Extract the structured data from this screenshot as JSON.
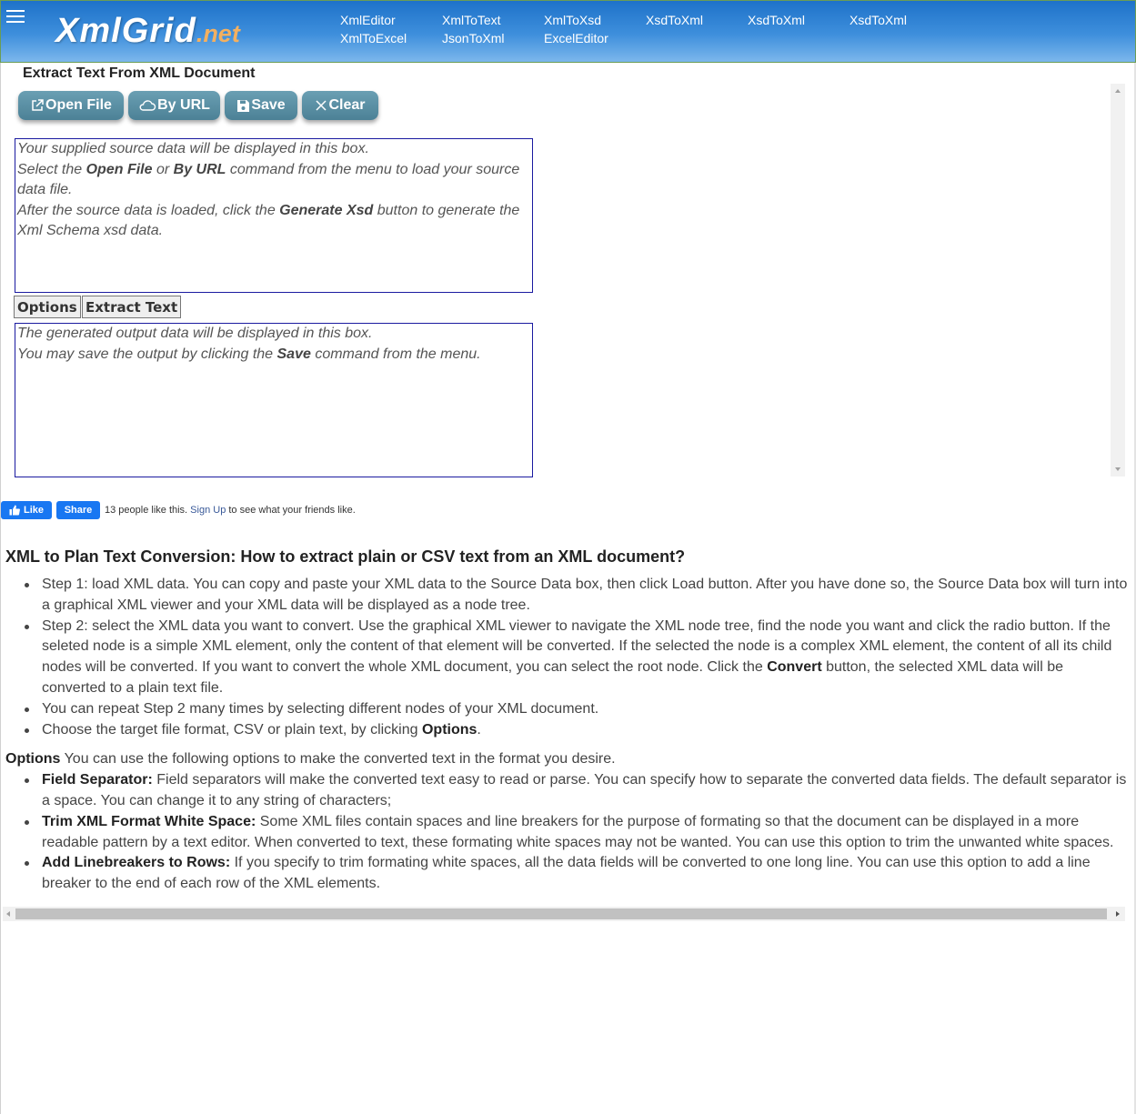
{
  "header": {
    "logo_main": "XmlGrid",
    "logo_ext": ".net",
    "nav": [
      {
        "label": "XmlEditor"
      },
      {
        "label": "XmlToText"
      },
      {
        "label": "XmlToXsd"
      },
      {
        "label": "XsdToXml"
      },
      {
        "label": "XsdToXml"
      },
      {
        "label": "XsdToXml"
      },
      {
        "label": "XmlToExcel"
      },
      {
        "label": "JsonToXml"
      },
      {
        "label": "ExcelEditor"
      }
    ]
  },
  "converter": {
    "title": "Extract Text From XML Document",
    "toolbar": {
      "open_file": "Open File",
      "by_url": "By URL",
      "save": "Save",
      "clear": "Clear"
    },
    "source_box": {
      "line1": "Your supplied source data will be displayed in this box.",
      "line2_a": "Select the ",
      "line2_b": "Open File",
      "line2_c": " or ",
      "line2_d": "By URL",
      "line2_e": " command from the menu to load your source data file.",
      "line3_a": "After the source data is loaded, click the ",
      "line3_b": "Generate Xsd",
      "line3_c": " button to generate the Xml Schema xsd data."
    },
    "options_button": "Options",
    "extract_button": "Extract Text",
    "output_box": {
      "line1": "The generated output data will be displayed in this box.",
      "line2_a": "You may save the output by clicking the ",
      "line2_b": "Save",
      "line2_c": " command from the menu."
    }
  },
  "facebook": {
    "like": "Like",
    "share": "Share",
    "text_a": "13 people like this. ",
    "signup": "Sign Up",
    "text_b": " to see what your friends like."
  },
  "article": {
    "title": "XML to Plan Text Conversion: How to extract plain or CSV text from an XML document?",
    "steps": [
      {
        "text": "Step 1: load XML data. You can copy and paste your XML data to the Source Data box, then click Load button. After you have done so, the Source Data box will turn into a graphical XML viewer and your XML data will be displayed as a node tree."
      },
      {
        "text_a": "Step 2: select the XML data you want to convert. Use the graphical XML viewer to navigate the XML node tree, find the node you want and click the radio button. If the seleted node is a simple XML element, only the content of that element will be converted. If the selected the node is a complex XML element, the content of all its child nodes will be converted. If you want to convert the whole XML document, you can select the root node. Click the ",
        "bold": "Convert",
        "text_b": " button, the selected XML data will be converted to a plain text file."
      },
      {
        "text": "You can repeat Step 2 many times by selecting different nodes of your XML document."
      },
      {
        "text_a": "Choose the target file format, CSV or plain text, by clicking ",
        "bold": "Options",
        "text_b": "."
      }
    ],
    "options_label": "Options",
    "options_intro": " You can use the following options to make the converted text in the format you desire.",
    "options": [
      {
        "label": "Field Separator:",
        "text": " Field separators will make the converted text easy to read or parse. You can specify how to separate the converted data fields. The default separator is a space. You can change it to any string of characters;"
      },
      {
        "label": "Trim XML Format White Space:",
        "text": " Some XML files contain spaces and line breakers for the purpose of formating so that the document can be displayed in a more readable pattern by a text editor. When converted to text, these formating white spaces may not be wanted. You can use this option to trim the unwanted white spaces."
      },
      {
        "label": "Add Linebreakers to Rows:",
        "text": " If you specify to trim formating white spaces, all the data fields will be converted to one long line. You can use this option to add a line breaker to the end of each row of the XML elements."
      }
    ]
  }
}
